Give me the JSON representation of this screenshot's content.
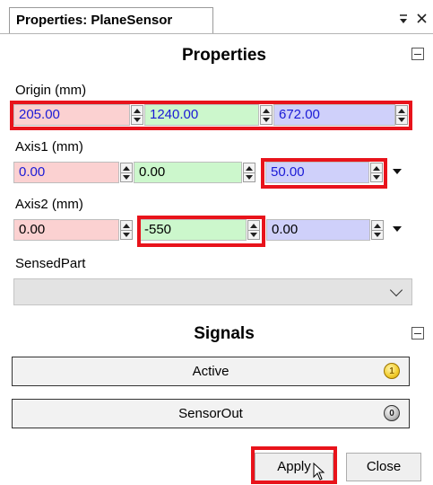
{
  "window": {
    "tab_title": "Properties: PlaneSensor",
    "pin_icon": "dropdown-pin-icon",
    "close_icon": "close-icon"
  },
  "properties": {
    "title": "Properties",
    "origin": {
      "label": "Origin (mm)",
      "x": "205.00",
      "y": "1240.00",
      "z": "672.00"
    },
    "axis1": {
      "label": "Axis1 (mm)",
      "x": "0.00",
      "y": "0.00",
      "z": "50.00"
    },
    "axis2": {
      "label": "Axis2 (mm)",
      "x": "0.00",
      "y": "-550",
      "z": "0.00"
    },
    "sensed_part": {
      "label": "SensedPart",
      "value": ""
    }
  },
  "signals": {
    "title": "Signals",
    "items": [
      {
        "label": "Active",
        "indicator_value": "1"
      },
      {
        "label": "SensorOut",
        "indicator_value": "0"
      }
    ]
  },
  "buttons": {
    "apply": "Apply",
    "close": "Close"
  },
  "colors": {
    "x_field": "#fbd1d1",
    "y_field": "#ccf7cc",
    "z_field": "#cfd0fa",
    "highlight": "#e8131b",
    "value_text": "#1a1ad6"
  }
}
